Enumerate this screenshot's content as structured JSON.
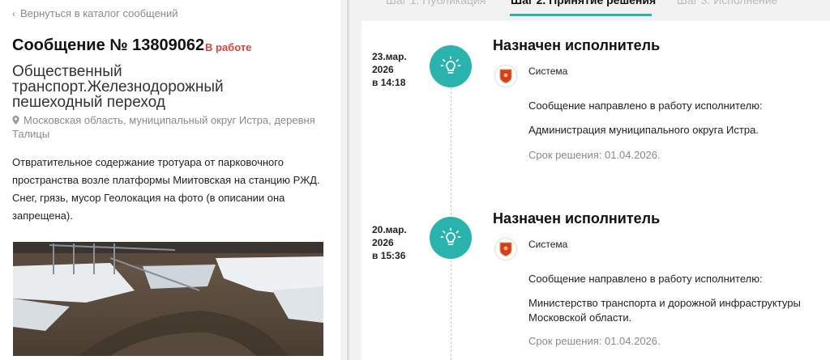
{
  "nav": {
    "back_label": "Вернуться в каталог сообщений"
  },
  "message": {
    "title": "Сообщение № 13809062",
    "status": "В работе",
    "category": "Общественный транспорт.Железнодорожный пешеходный переход",
    "location": "Московская область, муниципальный округ Истра, деревня Талицы",
    "description": "Отвратительное содержание тротуара от парковочного пространства возле платформы Миитовская на станцию РЖД. Снег, грязь, мусор Геолокация на фото (в описании она запрещена)."
  },
  "tabs": [
    {
      "label": "Шаг 1. Публикация"
    },
    {
      "label": "Шаг 2. Принятие решения"
    },
    {
      "label": "Шаг 3. Исполнение"
    }
  ],
  "timeline": [
    {
      "date_line1": "23.мар.",
      "date_line2": "2026",
      "date_line3": "в 14:18",
      "title": "Назначен исполнитель",
      "author": "Система",
      "text1": "Сообщение направлено в работу исполнителю:",
      "text2": "Администрация муниципального округа Истра.",
      "deadline": "Срок решения: 01.04.2026."
    },
    {
      "date_line1": "20.мар.",
      "date_line2": "2026",
      "date_line3": "в 15:36",
      "title": "Назначен исполнитель",
      "author": "Система",
      "text1": "Сообщение направлено в работу исполнителю:",
      "text2": "Министерство транспорта и дорожной инфраструктуры Московской области.",
      "deadline": "Срок решения: 01.04.2026."
    }
  ],
  "colors": {
    "accent": "#2ab3ad",
    "status": "#e2403b",
    "muted": "#8a8a8a"
  },
  "icons": {
    "back": "chevron-left-icon",
    "location": "map-pin-icon",
    "event": "lightbulb-icon",
    "avatar": "moscow-region-emblem-icon"
  }
}
